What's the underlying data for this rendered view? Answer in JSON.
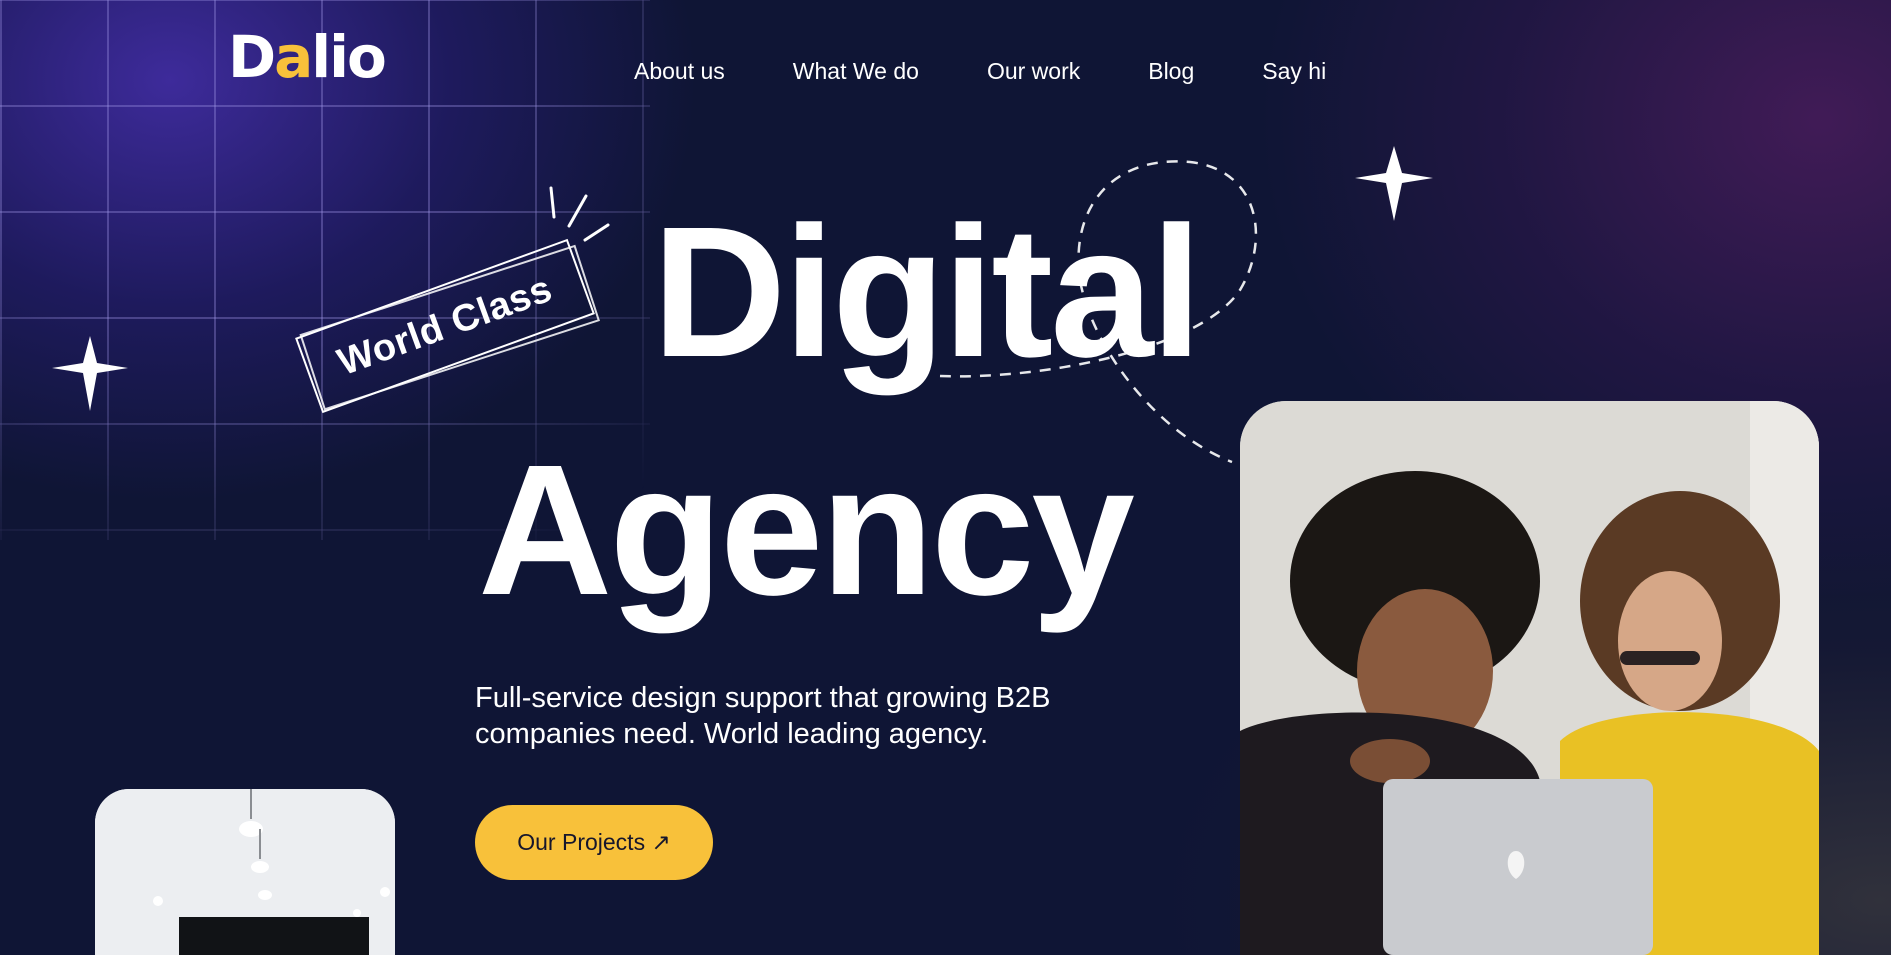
{
  "brand": {
    "logo_part1": "D",
    "logo_accent": "a",
    "logo_part2": "lio",
    "accent_color": "#f8c13a"
  },
  "nav": {
    "items": [
      {
        "label": "About us"
      },
      {
        "label": "What We do"
      },
      {
        "label": "Our work"
      },
      {
        "label": "Blog"
      },
      {
        "label": "Say hi"
      }
    ]
  },
  "hero": {
    "headline_line1": "Digital",
    "headline_line2": "Agency",
    "badge": "World Class",
    "subtitle_line1": "Full-service design support that growing B2B",
    "subtitle_line2": "companies need. World leading agency.",
    "cta_label": "Our Projects ↗"
  },
  "images": {
    "main_photo": "two-women-at-laptop-photo",
    "small_photo": "office-ceiling-lights-photo"
  },
  "colors": {
    "background": "#0f1535",
    "cta_background": "#f8c13a",
    "cta_text": "#16162c"
  }
}
